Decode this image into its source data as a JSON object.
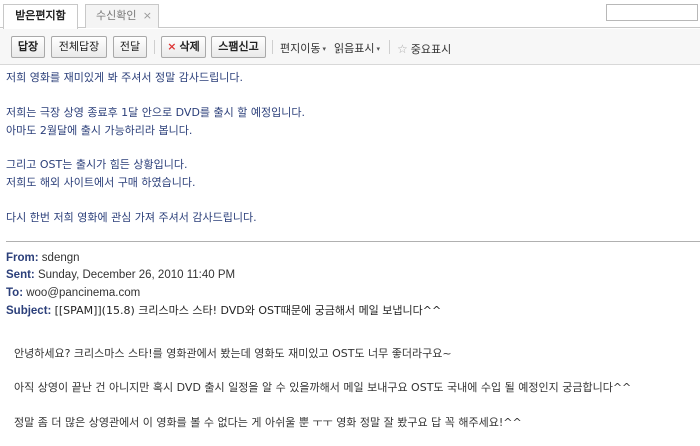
{
  "tabs": {
    "inbox": "받은편지함",
    "receipt": "수신확인",
    "close": "×"
  },
  "toolbar": {
    "reply": "답장",
    "reply_all": "전체답장",
    "forward": "전달",
    "delete_icon": "×",
    "delete": "삭제",
    "spam": "스팸신고",
    "move": "편지이동",
    "read_mark": "읽음표시",
    "important": "중요표시",
    "caret": "▾",
    "star": "☆"
  },
  "reply_body": [
    "저희 영화를 재미있게 봐 주셔서 정말 감사드립니다.",
    "저희는 극장 상영 종료후 1달 안으로 DVD를 출시 할 예정입니다.",
    "아마도 2월달에 출시 가능하리라 봅니다.",
    "그리고 OST는 출시가 힘든 상황입니다.",
    "저희도 해외 사이트에서 구매 하였습니다.",
    "다시 한번 저희 영화에 관심 가져 주셔서 감사드립니다."
  ],
  "original_header": {
    "from_label": "From:",
    "from": "sdengn",
    "sent_label": "Sent:",
    "sent": "Sunday, December 26, 2010 11:40 PM",
    "to_label": "To:",
    "to": "woo@pancinema.com",
    "subject_label": "Subject:",
    "subject": "[[SPAM]](15.8) 크리스마스 스타! DVD와 OST때문에 궁금해서 메일 보냅니다^^"
  },
  "original_body": [
    "안녕하세요? 크리스마스 스타!를 영화관에서 봤는데 영화도 재미있고 OST도 너무 좋더라구요~",
    "아직 상영이 끝난 건 아니지만 혹시 DVD 출시 일정을 알 수 있을까해서 메일 보내구요 OST도 국내에 수입 될 예정인지 궁금합니다^^",
    "정말 좀 더 많은 상영관에서 이 영화를 볼 수 없다는 게 아쉬울 뿐 ㅜㅜ 영화 정말 잘 봤구요 답 꼭 해주세요!^^"
  ],
  "colors": {
    "body_text": "#2b3f7a",
    "delete_icon": "#dd3333"
  }
}
